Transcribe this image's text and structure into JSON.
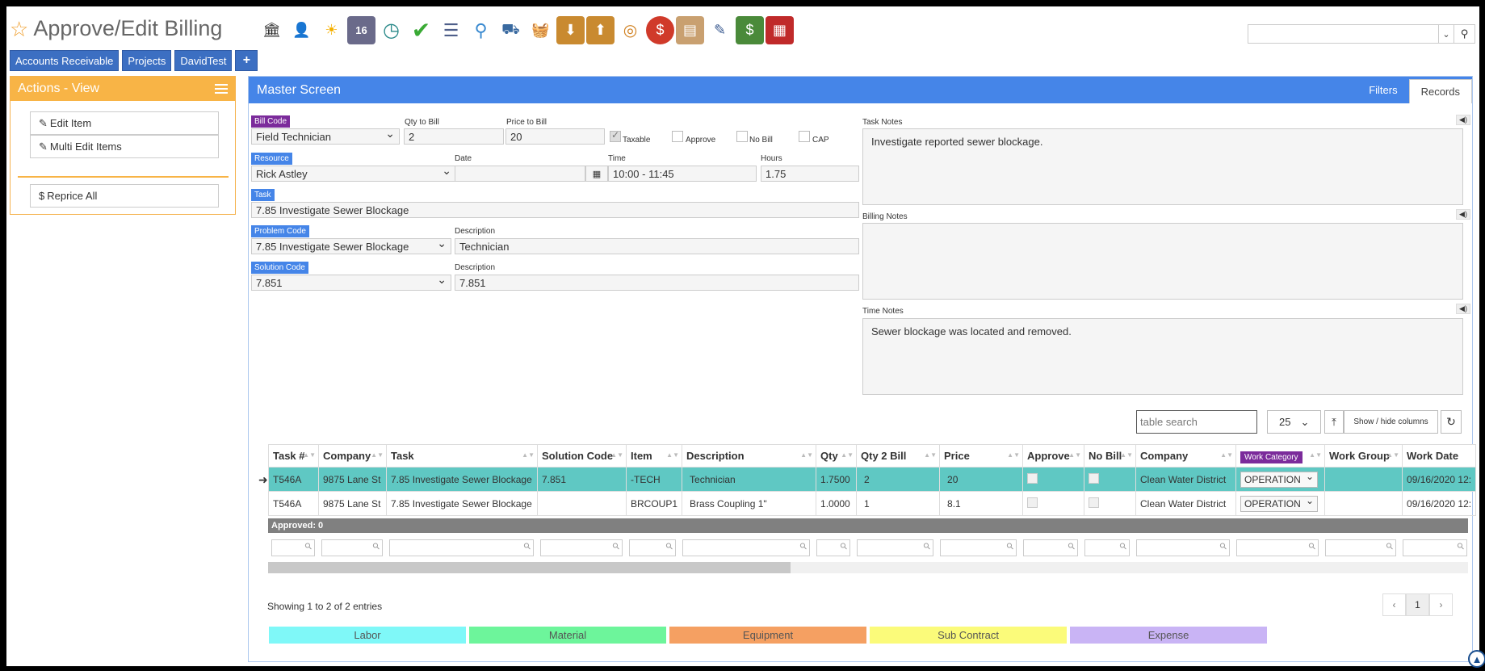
{
  "header": {
    "title": "Approve/Edit Billing",
    "toolbar_icons": [
      "bank-icon",
      "user-icon",
      "weather-icon",
      "calendar-icon",
      "clock-icon",
      "check-icon",
      "list-icon",
      "magnify-icon",
      "truck-icon",
      "basket-icon",
      "download-icon",
      "upload-icon",
      "coins-icon",
      "chat-dollar-icon",
      "clipboard-icon",
      "pencil-icon",
      "money-icon",
      "building-icon"
    ],
    "calendar_day": "16",
    "search_placeholder": ""
  },
  "tabs": [
    "Accounts Receivable",
    "Projects",
    "DavidTest",
    "+"
  ],
  "actions": {
    "title": "Actions - View",
    "items": [
      "Edit Item",
      "Multi Edit Items",
      "Reprice All"
    ]
  },
  "master": {
    "title": "Master Screen",
    "tabs": [
      "Filters",
      "Records"
    ]
  },
  "form": {
    "bill_code_label": "Bill Code",
    "bill_code": "Field Technician",
    "qty_label": "Qty to Bill",
    "qty": "2",
    "price_label": "Price to Bill",
    "price": "20",
    "taxable_label": "Taxable",
    "approve_label": "Approve",
    "nobill_label": "No Bill",
    "cap_label": "CAP",
    "resource_label": "Resource",
    "resource": "Rick Astley",
    "date_label": "Date",
    "date": "",
    "time_label": "Time",
    "time": "10:00 - 11:45",
    "hours_label": "Hours",
    "hours": "1.75",
    "task_label": "Task",
    "task": "7.85 Investigate Sewer Blockage",
    "problem_label": "Problem Code",
    "problem": "7.85 Investigate Sewer Blockage",
    "problem_desc_label": "Description",
    "problem_desc": "Technician",
    "solution_label": "Solution Code",
    "solution": "7.851",
    "solution_desc_label": "Description",
    "solution_desc": "7.851",
    "task_notes_label": "Task Notes",
    "task_notes": "Investigate reported sewer blockage.",
    "billing_notes_label": "Billing Notes",
    "billing_notes": "",
    "time_notes_label": "Time Notes",
    "time_notes": "Sewer blockage was located and removed."
  },
  "table": {
    "search_placeholder": "table search",
    "page_length": "25",
    "show_hide": "Show / hide columns",
    "columns": [
      "Task #",
      "Company",
      "Task",
      "Solution Code",
      "Item",
      "Description",
      "Qty",
      "Qty 2 Bill",
      "Price",
      "Approve",
      "No Bill",
      "Company",
      "Work Category",
      "Work Group",
      "Work Date"
    ],
    "rows": [
      [
        "T546A",
        "9875 Lane St",
        "7.85 Investigate Sewer Blockage",
        "7.851",
        "-TECH",
        "Technician",
        "1.7500",
        "2",
        "20",
        "",
        "",
        "Clean Water District",
        "OPERATION",
        "",
        "09/16/2020 12:"
      ],
      [
        "T546A",
        "9875 Lane St",
        "7.85 Investigate Sewer Blockage",
        "",
        "BRCOUP1",
        "Brass Coupling 1\"",
        "1.0000",
        "1",
        "8.1",
        "",
        "",
        "Clean Water District",
        "OPERATION",
        "",
        "09/16/2020 12:"
      ]
    ],
    "approved_label": "Approved: 0",
    "showing": "Showing 1 to 2 of 2 entries",
    "pager": [
      "‹",
      "1",
      "›"
    ]
  },
  "legend": [
    {
      "label": "Labor",
      "color": "#7ff8f8"
    },
    {
      "label": "Material",
      "color": "#6df59b"
    },
    {
      "label": "Equipment",
      "color": "#f5a062"
    },
    {
      "label": "Sub Contract",
      "color": "#fbfb7a"
    },
    {
      "label": "Expense",
      "color": "#c9b4f5"
    }
  ]
}
